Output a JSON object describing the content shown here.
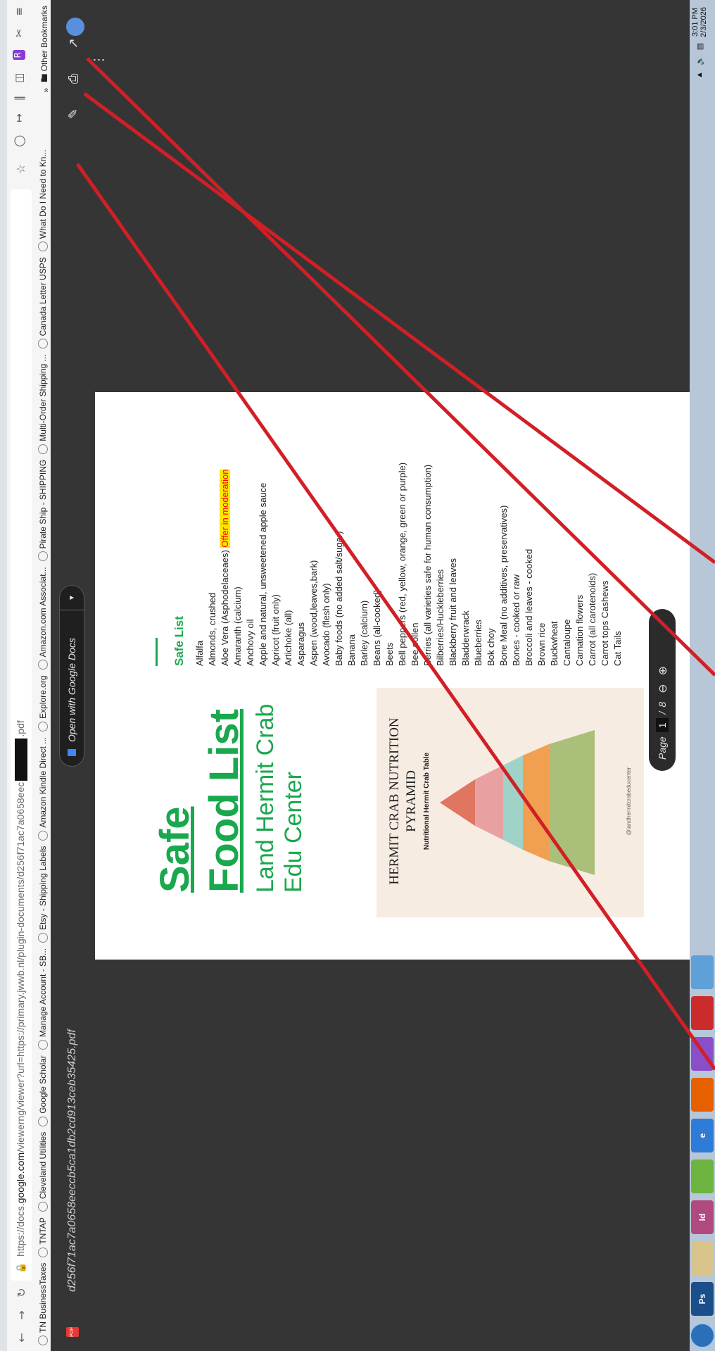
{
  "browser": {
    "url_prefix": "https://docs.",
    "url_host": "google.com",
    "url_path": "/viewerng/viewer?url=https://primary.jwwb.nl/plugin-documents/d256f71ac7a0658eec",
    "url_suffix": ".pdf",
    "bookmarks": [
      {
        "label": "TN BusinessTaxes",
        "icon": "globe-icon"
      },
      {
        "label": "TNTAP",
        "icon": "globe-icon"
      },
      {
        "label": "Cleveland Utilities",
        "icon": "globe-icon"
      },
      {
        "label": "Google Scholar",
        "icon": "globe-icon"
      },
      {
        "label": "Manage Account - SB...",
        "icon": "account-icon"
      },
      {
        "label": "Etsy - Shipping Labels",
        "icon": "etsy-icon"
      },
      {
        "label": "Amazon Kindle Direct ...",
        "icon": "globe-icon"
      },
      {
        "label": "Explore.org",
        "icon": "globe-icon"
      },
      {
        "label": "Amazon.com Associat...",
        "icon": "globe-icon"
      },
      {
        "label": "Pirate Ship - SHIPPING",
        "icon": "globe-icon"
      },
      {
        "label": "Multi-Order Shipping ...",
        "icon": "paypal-icon"
      },
      {
        "label": "Canada Letter USPS",
        "icon": "usps-icon"
      },
      {
        "label": "What Do I Need to Kn...",
        "icon": "globe-icon"
      }
    ],
    "other_bookmarks": "Other Bookmarks"
  },
  "viewer": {
    "file_title": "d256f71ac7a0658eeccb5ca1db2cd913ceb35425.pdf",
    "open_with": "Open with Google Docs",
    "page_label": "Page",
    "page_current": "1",
    "page_sep": "/",
    "page_total": "8"
  },
  "document": {
    "title_line1": "Safe",
    "title_line2": "Food List",
    "subtitle_line1": "Land Hermit Crab",
    "subtitle_line2": "Edu Center",
    "pyramid_title": "HERMIT CRAB NUTRITION PYRAMID",
    "pyramid_subtitle": "Nutritional Hermit Crab Table",
    "pyramid_credit": "@landhermitcrabeducenter",
    "safe_list_heading": "Safe List",
    "safe_list": [
      "Alfalfa",
      "Almonds, crushed",
      "Aloe Vera (Asphodelaceaes) Offer in moderation",
      "Amaranth (calcium)",
      "Anchovy oil",
      "Apple and natural, unsweetened apple sauce",
      "Apricot (fruit only)",
      "Artichoke (all)",
      "Asparagus",
      "Aspen (wood,leaves,bark)",
      "Avocado (flesh only)",
      "Baby foods (no added salt/sugar)",
      "Banana",
      "Barley (calcium)",
      "Beans (all-cooked)",
      "Beets",
      "Bell peppers (red, yellow, orange, green or purple)",
      "Bee pollen",
      "Berries (all varieties safe for human consumption)",
      "Bilberries/Huckleberries",
      "Blackberry fruit and leaves",
      "Bladderwrack",
      "Blueberries",
      "Bok choy",
      "Bone Meal (no additives, preservatives)",
      "Bones - cooked or raw",
      "Broccoli and leaves - cooked",
      "Brown rice",
      "Buckwheat",
      "Cantaloupe",
      "Carnation flowers",
      "Carrot (all carotenoids)",
      "Carrot tops Cashews",
      "Cat Tails"
    ]
  },
  "system": {
    "time": "3:01 PM",
    "date": "2/3/2026"
  }
}
